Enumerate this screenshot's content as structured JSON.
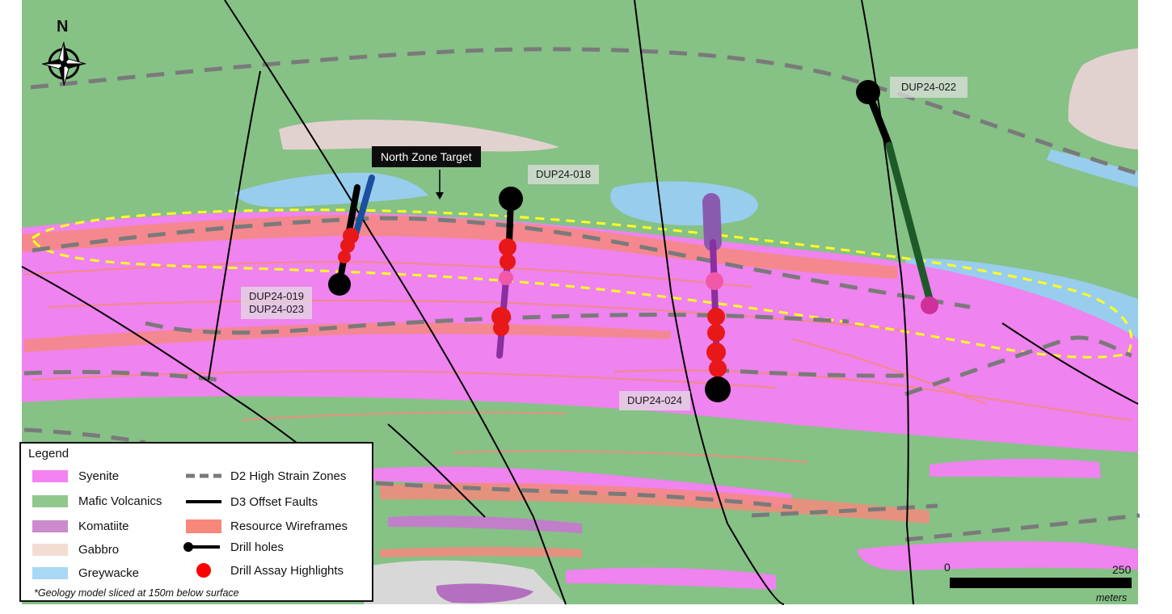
{
  "compass": {
    "letter": "N",
    "icon": "compass-rose-icon"
  },
  "target_label": "North Zone Target",
  "drill_labels": {
    "dup018": "DUP24-018",
    "dup019_023": "DUP24-019\nDUP24-023",
    "dup022": "DUP24-022",
    "dup024": "DUP24-024"
  },
  "legend": {
    "title": "Legend",
    "units": [
      {
        "label": "Syenite",
        "color": "#f383f3"
      },
      {
        "label": "Mafic Volcanics",
        "color": "#8fc88c"
      },
      {
        "label": "Komatiite",
        "color": "#cc8bcc"
      },
      {
        "label": "Gabbro",
        "color": "#f3ddd3"
      },
      {
        "label": "Greywacke",
        "color": "#a9d8f5"
      }
    ],
    "features": [
      {
        "label": "D2 High Strain Zones",
        "icon": "dashed-line-icon"
      },
      {
        "label": "D3 Offset Faults",
        "icon": "solid-line-icon"
      },
      {
        "label": "Resource Wireframes",
        "icon": "salmon-swatch-icon",
        "color": "#f7877a"
      },
      {
        "label": "Drill holes",
        "icon": "drill-hole-icon"
      },
      {
        "label": "Drill Assay Highlights",
        "icon": "red-dot-icon",
        "color": "#ff0000"
      }
    ],
    "note": "*Geology model sliced at 150m below surface"
  },
  "scale": {
    "start": "0",
    "end": "250",
    "unit": "meters"
  },
  "colors": {
    "mafic": "#86c186",
    "syenite": "#ef83ef",
    "komatiite": "#b46fc0",
    "gabbro": "#e2d2cf",
    "greywacke": "#98cdee",
    "wireframe": "#f48a7c",
    "target_outline": "#ffff22",
    "strain_zone": "#7a7a7a",
    "assay": "#e81818"
  }
}
